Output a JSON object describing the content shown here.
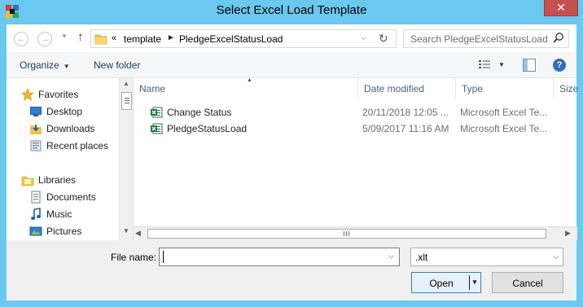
{
  "window": {
    "title": "Select Excel Load Template",
    "close_glyph": "✕",
    "app_icon": "app-icon"
  },
  "nav": {
    "back_glyph": "←",
    "forward_glyph": "→",
    "recent_glyph": "▼",
    "up_glyph": "↑",
    "address": {
      "overflow": "«",
      "crumbs": [
        "template",
        "PledgeExcelStatusLoad"
      ],
      "separator": "►",
      "drop_glyph": "⌵",
      "refresh_glyph": "↻"
    },
    "search": {
      "placeholder": "Search PledgeExcelStatusLoad",
      "icon": "search-icon"
    }
  },
  "toolbar": {
    "organize": "Organize",
    "organize_caret": "▼",
    "new_folder": "New folder",
    "view_caret": "▼",
    "help_glyph": "?"
  },
  "sidebar": {
    "items": [
      {
        "label": "Favorites",
        "icon": "star-icon",
        "group": true
      },
      {
        "label": "Desktop",
        "icon": "desktop-icon"
      },
      {
        "label": "Downloads",
        "icon": "downloads-icon"
      },
      {
        "label": "Recent places",
        "icon": "recent-places-icon"
      },
      {
        "label": "Libraries",
        "icon": "libraries-icon",
        "group": true
      },
      {
        "label": "Documents",
        "icon": "documents-icon"
      },
      {
        "label": "Music",
        "icon": "music-icon"
      },
      {
        "label": "Pictures",
        "icon": "pictures-icon"
      }
    ]
  },
  "files": {
    "columns": [
      "Name",
      "Date modified",
      "Type",
      "Size"
    ],
    "sort_glyph": "▲",
    "rows": [
      {
        "name": "Change Status",
        "date": "20/11/2018 12:05 ...",
        "type": "Microsoft Excel Te...",
        "icon": "excel-template-icon"
      },
      {
        "name": "PledgeStatusLoad",
        "date": "5/09/2017 11:16 AM",
        "type": "Microsoft Excel Te...",
        "icon": "excel-template-icon"
      }
    ]
  },
  "scroll": {
    "up": "▲",
    "down": "▼",
    "left": "◀",
    "right": "▶"
  },
  "bottom": {
    "file_name_label": "File name:",
    "file_name_value": "",
    "file_name_drop": "⌵",
    "file_type_value": ".xlt",
    "file_type_drop": "⌵",
    "open_label": "Open",
    "open_drop": "▼",
    "cancel_label": "Cancel"
  },
  "colors": {
    "title_bar": "#6bc8ee",
    "close": "#c75050",
    "excel_green": "#217346",
    "folder_yellow": "#f5c343",
    "accent_blue": "#3c7fb1"
  }
}
